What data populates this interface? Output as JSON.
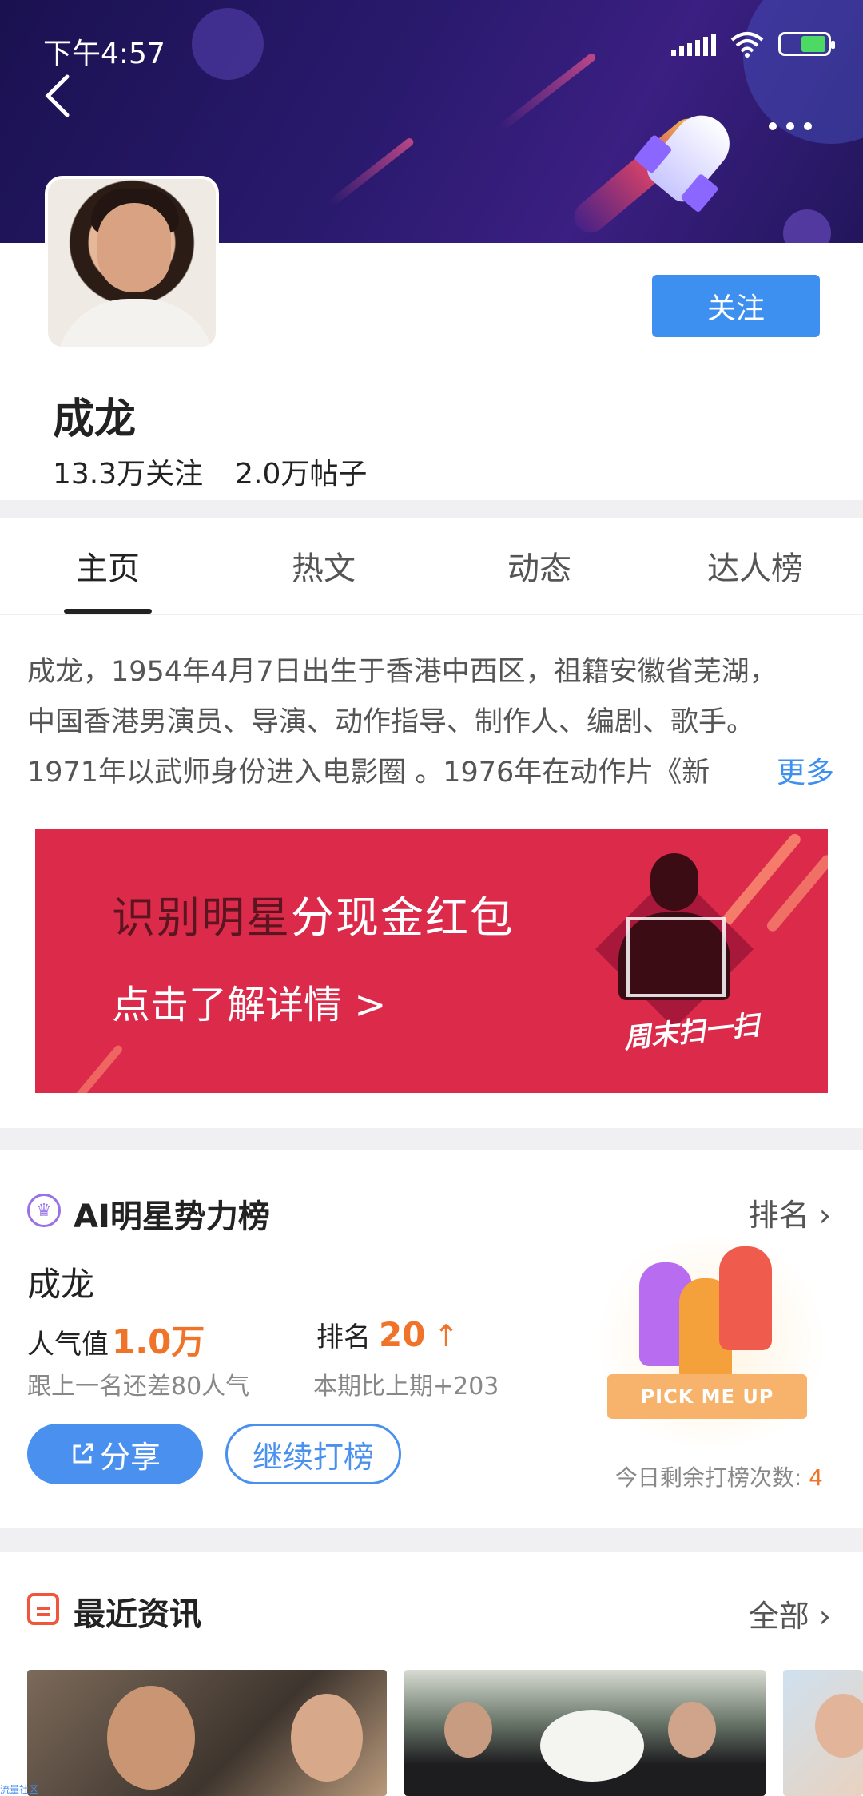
{
  "status_bar": {
    "time": "下午4:57",
    "colors": {
      "battery_fill": "#4cd964"
    }
  },
  "header": {
    "back_icon": "chevron-left-icon",
    "more_icon": "more-dots-icon"
  },
  "profile": {
    "name": "成龙",
    "follow_label": "关注",
    "followers": "13.3万关注",
    "posts": "2.0万帖子"
  },
  "tabs": [
    {
      "label": "主页",
      "active": true
    },
    {
      "label": "热文",
      "active": false
    },
    {
      "label": "动态",
      "active": false
    },
    {
      "label": "达人榜",
      "active": false
    }
  ],
  "bio": {
    "lines": [
      "成龙，1954年4月7日出生于香港中西区，祖籍安徽省芜湖，",
      "中国香港男演员、导演、动作指导、制作人、编剧、歌手。",
      "1971年以武师身份进入电影圈 。1976年在动作片《新"
    ],
    "more_label": "更多"
  },
  "promo": {
    "title_part1": "识别明星",
    "title_part2": "分现金红包",
    "subtitle": "点击了解详情 >",
    "tag": "周末扫一扫"
  },
  "ranking": {
    "title": "AI明星势力榜",
    "link": "排名",
    "star_name": "成龙",
    "popularity_label": "人气值",
    "popularity_value": "1.0万",
    "rank_label": "排名",
    "rank_value": "20",
    "rank_trend_icon": "arrow-up-icon",
    "gap_note": "跟上一名还差80人气",
    "rank_note": "本期比上期+203",
    "share_label": "分享",
    "vote_label": "继续打榜",
    "badge_text": "PICK ME UP",
    "remaining_label": "今日剩余打榜次数:",
    "remaining_count": "4",
    "colors": {
      "accent": "#f0732a",
      "button": "#4a90ef"
    }
  },
  "news": {
    "title": "最近资讯",
    "all_label": "全部"
  },
  "footer": {
    "watermark": "流量社区"
  }
}
